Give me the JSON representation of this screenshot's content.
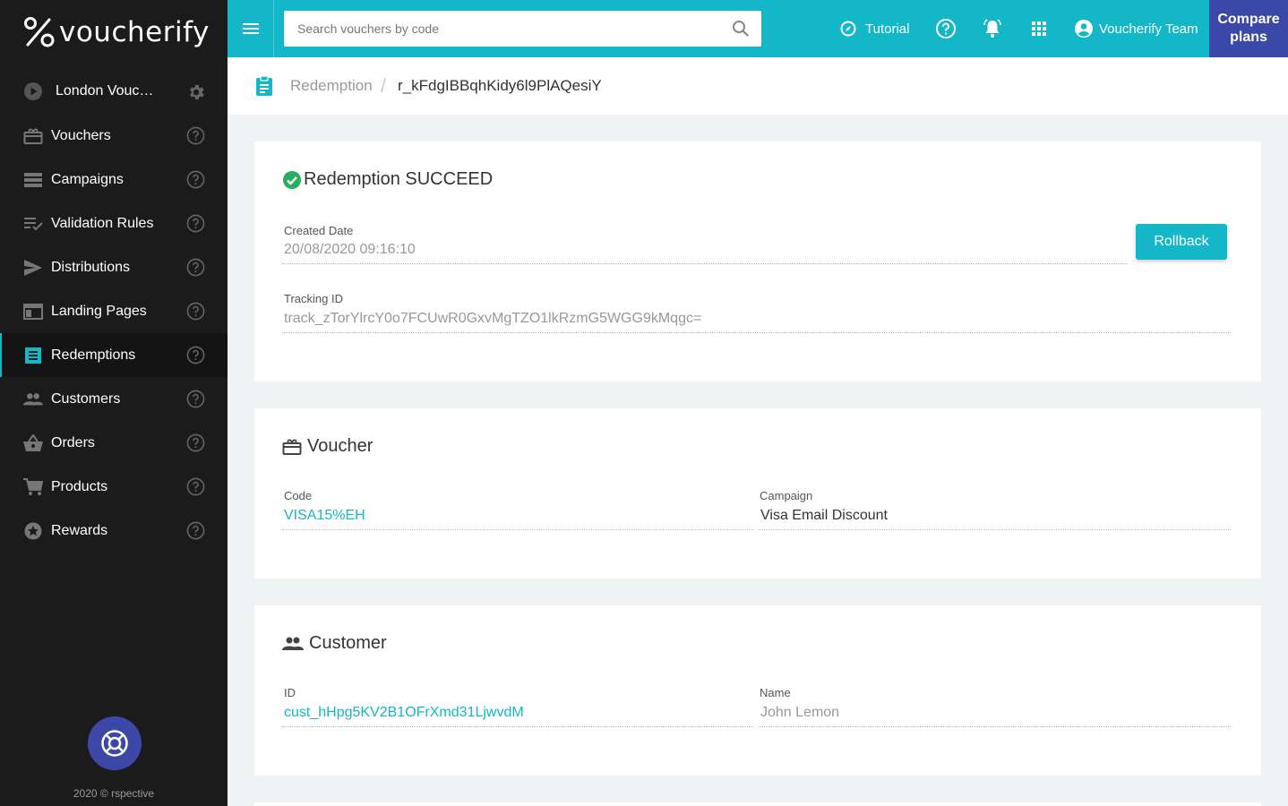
{
  "brand": {
    "name": "voucherify"
  },
  "sidebar": {
    "project": "London Vouc…",
    "items": [
      {
        "label": "Vouchers",
        "icon": "voucher-icon"
      },
      {
        "label": "Campaigns",
        "icon": "campaigns-icon"
      },
      {
        "label": "Validation Rules",
        "icon": "validation-rules-icon"
      },
      {
        "label": "Distributions",
        "icon": "distributions-icon"
      },
      {
        "label": "Landing Pages",
        "icon": "landing-pages-icon"
      },
      {
        "label": "Redemptions",
        "icon": "redemptions-icon",
        "active": true
      },
      {
        "label": "Customers",
        "icon": "customers-icon"
      },
      {
        "label": "Orders",
        "icon": "orders-icon"
      },
      {
        "label": "Products",
        "icon": "products-icon"
      },
      {
        "label": "Rewards",
        "icon": "rewards-icon"
      }
    ],
    "copyright": "2020 © rspective"
  },
  "topbar": {
    "search_placeholder": "Search vouchers by code",
    "tutorial": "Tutorial",
    "team": "Voucherify Team",
    "compare": "Compare plans"
  },
  "breadcrumb": {
    "parent": "Redemption",
    "current": "r_kFdgIBBqhKidy6l9PlAQesiY"
  },
  "redemption": {
    "title": "Redemption SUCCEED",
    "created_label": "Created Date",
    "created_value": "20/08/2020 09:16:10",
    "tracking_label": "Tracking ID",
    "tracking_value": "track_zTorYlrcY0o7FCUwR0GxvMgTZO1lkRzmG5WGG9kMqgc=",
    "rollback": "Rollback"
  },
  "voucher": {
    "title": "Voucher",
    "code_label": "Code",
    "code_value": "VISA15%EH",
    "campaign_label": "Campaign",
    "campaign_value": "Visa Email Discount"
  },
  "customer": {
    "title": "Customer",
    "id_label": "ID",
    "id_value": "cust_hHpg5KV2B1OFrXmd31LjwvdM",
    "name_label": "Name",
    "name_value": "John Lemon"
  },
  "colors": {
    "accent": "#13b7c8",
    "sidebar": "#1b1b1b",
    "compare": "#3b48a8",
    "success": "#27ae60"
  }
}
